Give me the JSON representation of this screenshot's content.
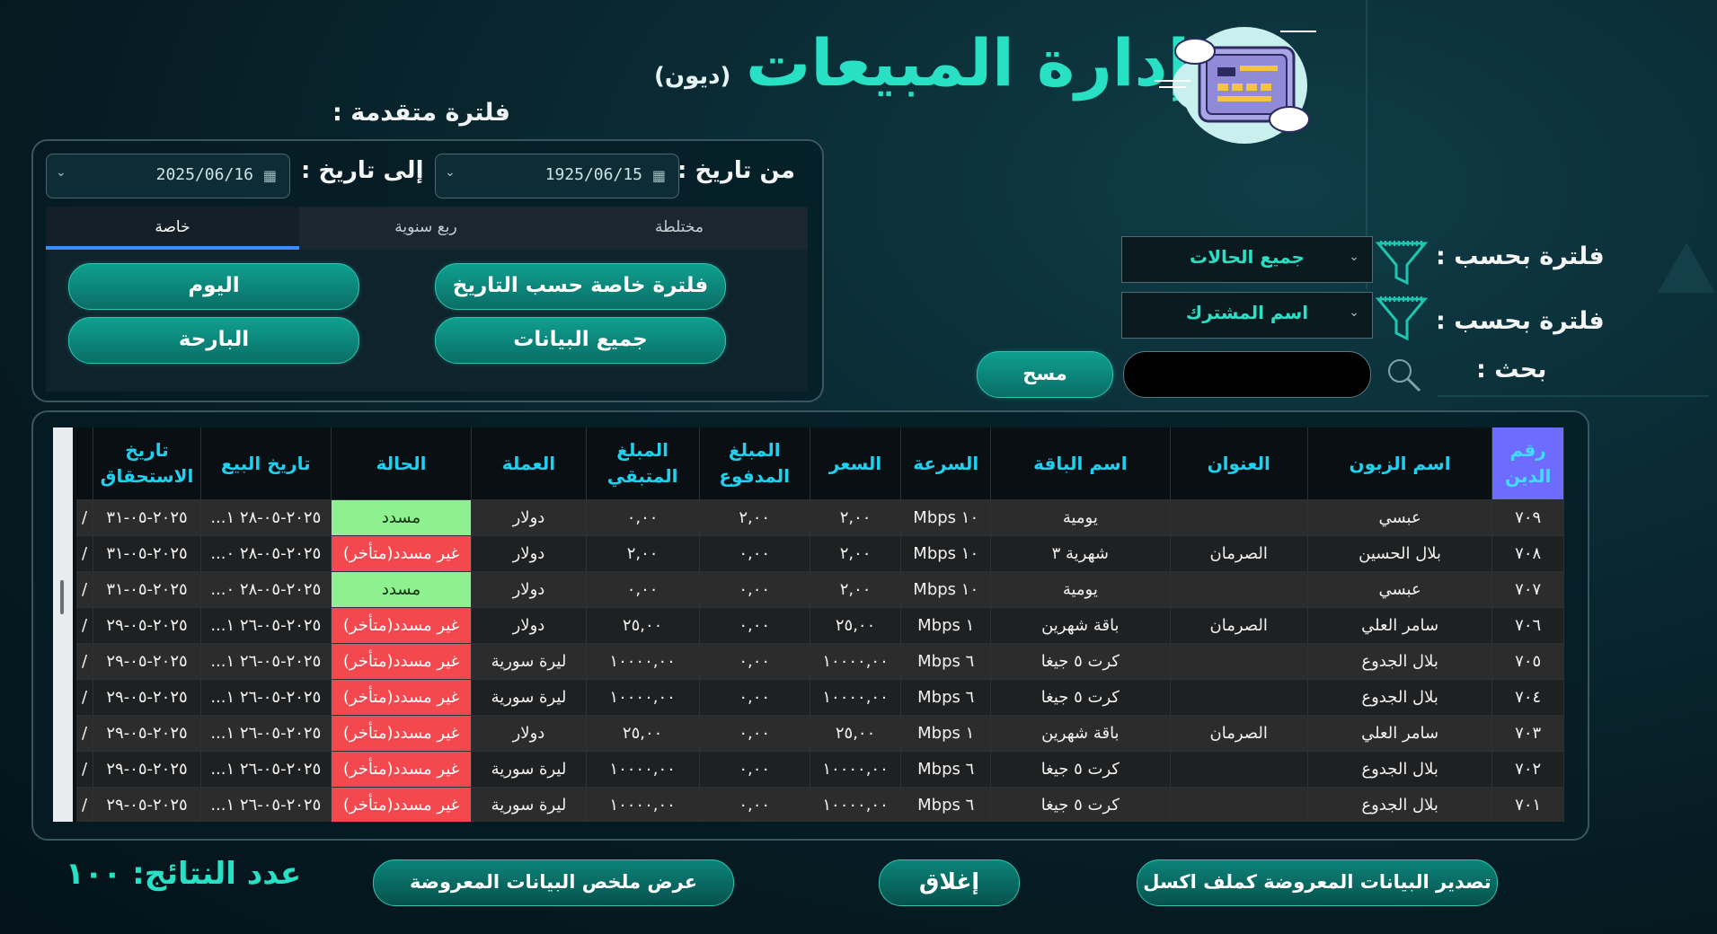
{
  "header": {
    "title": "إدارة المبيعات",
    "subtitle": "(ديون)"
  },
  "advanced_filter": {
    "label": "فلترة متقدمة :",
    "from_label": "من تاريخ :",
    "from_value": "1925/06/15",
    "to_label": "إلى تاريخ :",
    "to_value": "2025/06/16",
    "tabs": [
      "خاصة",
      "ربع سنوية",
      "مختلطة"
    ],
    "buttons": {
      "custom_date": "فلترة خاصة حسب التاريخ",
      "today": "اليوم",
      "all_data": "جميع البيانات",
      "yesterday": "البارحة"
    }
  },
  "filters": {
    "filter_label": "فلترة بحسب :",
    "status_value": "جميع الحالات",
    "field_value": "اسم المشترك",
    "search_label": "بحث :",
    "clear_button": "مسح"
  },
  "table": {
    "columns": [
      "رقم الدين",
      "اسم الزبون",
      "العنوان",
      "اسم الباقة",
      "السرعة",
      "السعر",
      "المبلغ المدفوع",
      "المبلغ المتبقي",
      "العملة",
      "الحالة",
      "تاريخ البيع",
      "تاريخ الاستحقاق"
    ],
    "rows": [
      [
        "٧٠٩",
        "عبسي",
        "",
        "يومية",
        "١٠ Mbps",
        "٢,٠٠",
        "٢,٠٠",
        "٠,٠٠",
        "دولار",
        "مسدد",
        "٢٠٢٥-٠٥-٢٨ ١...",
        "٢٠٢٥-٠٥-٣١",
        "/"
      ],
      [
        "٧٠٨",
        "بلال الحسين",
        "الصرمان",
        "شهرية ٣",
        "١٠ Mbps",
        "٢,٠٠",
        "٠,٠٠",
        "٢,٠٠",
        "دولار",
        "غير مسدد(متأخر)",
        "٢٠٢٥-٠٥-٢٨ ٠...",
        "٢٠٢٥-٠٥-٣١",
        "/"
      ],
      [
        "٧٠٧",
        "عبسي",
        "",
        "يومية",
        "١٠ Mbps",
        "٢,٠٠",
        "٠,٠٠",
        "٠,٠٠",
        "دولار",
        "مسدد",
        "٢٠٢٥-٠٥-٢٨ ٠...",
        "٢٠٢٥-٠٥-٣١",
        "/"
      ],
      [
        "٧٠٦",
        "سامر العلي",
        "الصرمان",
        "باقة شهرين",
        "١ Mbps",
        "٢٥,٠٠",
        "٠,٠٠",
        "٢٥,٠٠",
        "دولار",
        "غير مسدد(متأخر)",
        "٢٠٢٥-٠٥-٢٦ ١...",
        "٢٠٢٥-٠٥-٢٩",
        "/"
      ],
      [
        "٧٠٥",
        "بلال الجدوع",
        "",
        "كرت ٥ جيغا",
        "٦ Mbps",
        "١٠٠٠٠,٠٠",
        "٠,٠٠",
        "١٠٠٠٠,٠٠",
        "ليرة سورية",
        "غير مسدد(متأخر)",
        "٢٠٢٥-٠٥-٢٦ ١...",
        "٢٠٢٥-٠٥-٢٩",
        "/"
      ],
      [
        "٧٠٤",
        "بلال الجدوع",
        "",
        "كرت ٥ جيغا",
        "٦ Mbps",
        "١٠٠٠٠,٠٠",
        "٠,٠٠",
        "١٠٠٠٠,٠٠",
        "ليرة سورية",
        "غير مسدد(متأخر)",
        "٢٠٢٥-٠٥-٢٦ ١...",
        "٢٠٢٥-٠٥-٢٩",
        "/"
      ],
      [
        "٧٠٣",
        "سامر العلي",
        "الصرمان",
        "باقة شهرين",
        "١ Mbps",
        "٢٥,٠٠",
        "٠,٠٠",
        "٢٥,٠٠",
        "دولار",
        "غير مسدد(متأخر)",
        "٢٠٢٥-٠٥-٢٦ ١...",
        "٢٠٢٥-٠٥-٢٩",
        "/"
      ],
      [
        "٧٠٢",
        "بلال الجدوع",
        "",
        "كرت ٥ جيغا",
        "٦ Mbps",
        "١٠٠٠٠,٠٠",
        "٠,٠٠",
        "١٠٠٠٠,٠٠",
        "ليرة سورية",
        "غير مسدد(متأخر)",
        "٢٠٢٥-٠٥-٢٦ ١...",
        "٢٠٢٥-٠٥-٢٩",
        "/"
      ],
      [
        "٧٠١",
        "بلال الجدوع",
        "",
        "كرت ٥ جيغا",
        "٦ Mbps",
        "١٠٠٠٠,٠٠",
        "٠,٠٠",
        "١٠٠٠٠,٠٠",
        "ليرة سورية",
        "غير مسدد(متأخر)",
        "٢٠٢٥-٠٥-٢٦ ١...",
        "٢٠٢٥-٠٥-٢٩",
        "/"
      ]
    ],
    "status_colors": {
      "paid": "#8ff08f",
      "unpaid": "#f3484d"
    }
  },
  "footer": {
    "export_button": "تصدير البيانات المعروضة كملف اكسل",
    "close_button": "إغلاق",
    "summary_button": "عرض ملخص البيانات المعروضة",
    "result_count": "عدد النتائج: ١٠٠"
  },
  "icons": [
    "credit-card-cloud-icon",
    "filter-funnel-icon",
    "search-magnifier-icon",
    "calendar-icon",
    "chevron-down-icon"
  ],
  "colors": {
    "accent": "#28e0c4",
    "header_text": "#1fd0ef",
    "highlight_header": "#6e6bff"
  }
}
